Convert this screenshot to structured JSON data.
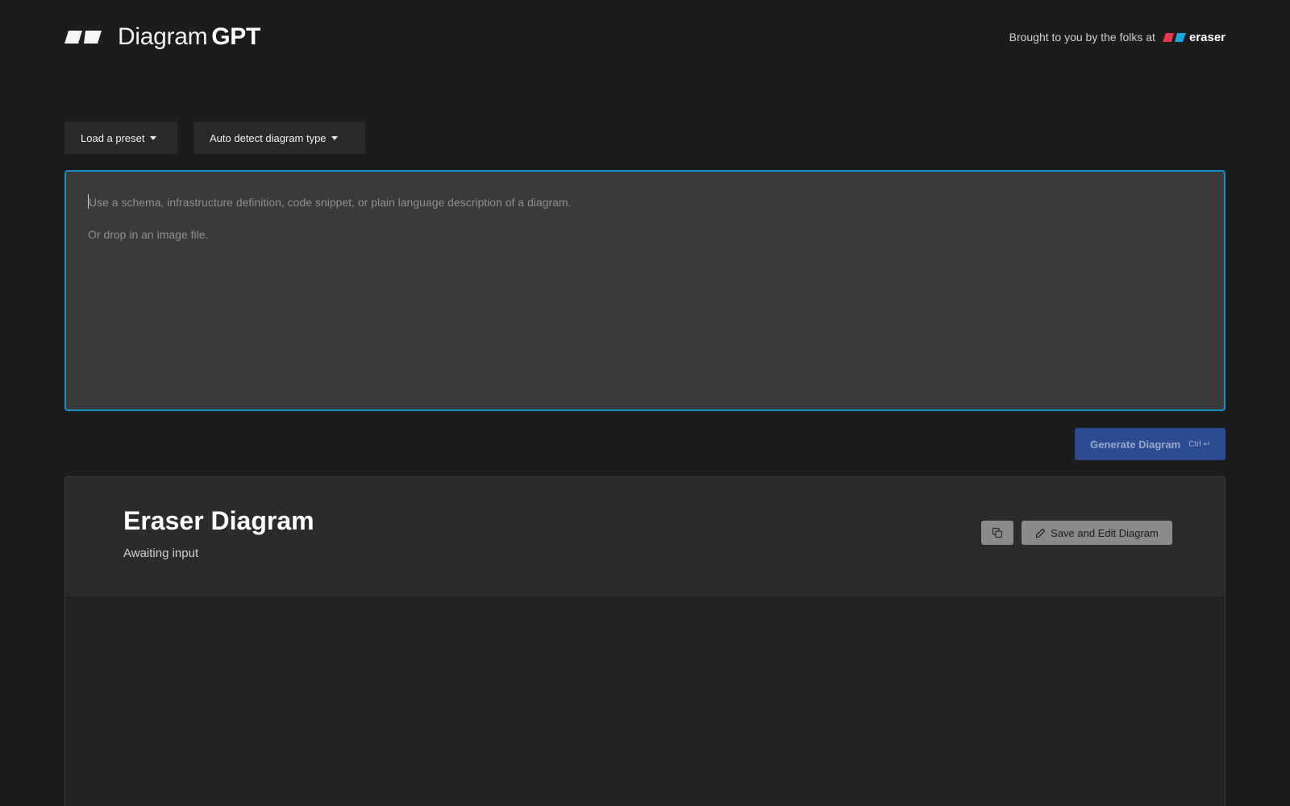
{
  "header": {
    "brand_light": "Diagram",
    "brand_bold": "GPT",
    "credit_text": "Brought to you by the folks at",
    "credit_link": "eraser"
  },
  "controls": {
    "preset_label": "Load a preset",
    "type_label": "Auto detect diagram type"
  },
  "prompt": {
    "placeholder_line1": "Use a schema, infrastructure definition, code snippet, or plain language description of a diagram.",
    "placeholder_line2": "Or drop in an image file.",
    "value": ""
  },
  "generate": {
    "label": "Generate Diagram",
    "shortcut": "Ctrl ↩"
  },
  "result": {
    "title": "Eraser Diagram",
    "status": "Awaiting input",
    "save_label": "Save and Edit Diagram"
  },
  "colors": {
    "background": "#1c1c1c",
    "accent_border": "#1391c5",
    "generate_button": "#2b4b93",
    "eraser_red": "#e8374b",
    "eraser_blue": "#1aa3e0"
  },
  "icons": {
    "brand": "diagramgpt-logo-icon",
    "eraser": "eraser-logo-icon",
    "copy": "copy-icon",
    "edit": "pencil-icon",
    "caret": "caret-down-icon"
  }
}
